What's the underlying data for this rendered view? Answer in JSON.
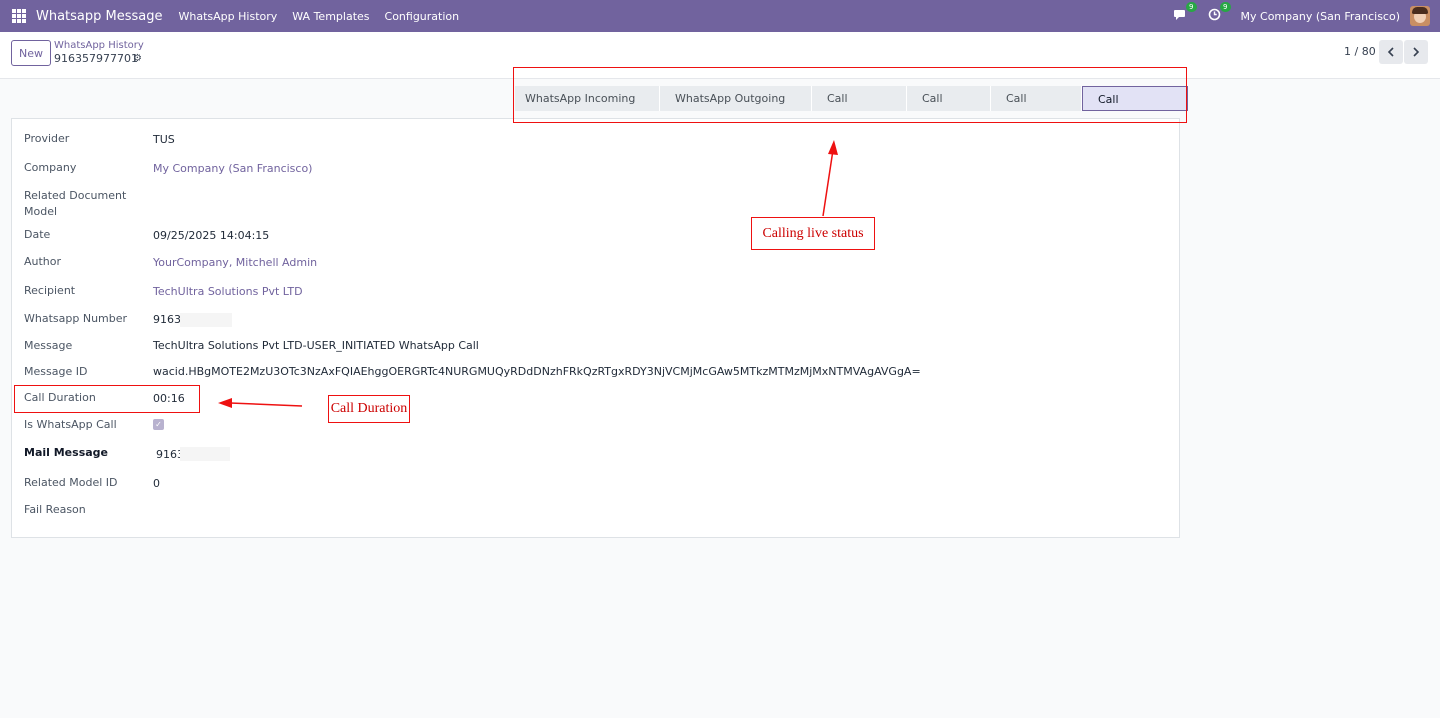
{
  "navbar": {
    "app_name": "Whatsapp Message",
    "menu": [
      "WhatsApp History",
      "WA Templates",
      "Configuration"
    ],
    "messages_badge": "9",
    "activity_badge": "9",
    "company": "My Company (San Francisco)",
    "bg_color": "#71639e"
  },
  "control": {
    "new_label": "New",
    "breadcrumb_parent": "WhatsApp History",
    "record_title": "916357977701",
    "pager": "1 / 80"
  },
  "statusbar": {
    "stages": [
      "WhatsApp Incoming Call",
      "WhatsApp Outgoing Call",
      "Call Accepted",
      "Call Ringing",
      "Call Rejected",
      "Call Completed"
    ],
    "active": "Call Completed"
  },
  "form": {
    "provider": {
      "label": "Provider",
      "value": "TUS"
    },
    "company": {
      "label": "Company",
      "value": "My Company (San Francisco)"
    },
    "related_document_model": {
      "label": "Related Document Model",
      "value": ""
    },
    "date": {
      "label": "Date",
      "value": "09/25/2025 14:04:15"
    },
    "author": {
      "label": "Author",
      "value": "YourCompany, Mitchell Admin"
    },
    "recipient": {
      "label": "Recipient",
      "value": "TechUltra Solutions Pvt LTD"
    },
    "whatsapp_number": {
      "label": "Whatsapp Number",
      "value": "9163"
    },
    "message": {
      "label": "Message",
      "value": "TechUltra Solutions Pvt LTD-USER_INITIATED WhatsApp Call"
    },
    "message_id": {
      "label": "Message ID",
      "value": "wacid.HBgMOTE2MzU3OTc3NzAxFQIAEhggOERGRTc4NURGMUQyRDdDNzhFRkQzRTgxRDY3NjVCMjMcGAw5MTkzMTMzMjMxNTMVAgAVGgA="
    },
    "call_duration": {
      "label": "Call Duration",
      "value": "00:16"
    },
    "is_whatsapp_call": {
      "label": "Is WhatsApp Call",
      "checked": true
    },
    "mail_message": {
      "label": "Mail Message",
      "value": "9163"
    },
    "related_model_id": {
      "label": "Related Model ID",
      "value": "0"
    },
    "fail_reason": {
      "label": "Fail Reason",
      "value": ""
    }
  },
  "annotations": {
    "status_note": "Calling live status",
    "duration_note": "Call Duration",
    "color": "#e11111"
  }
}
